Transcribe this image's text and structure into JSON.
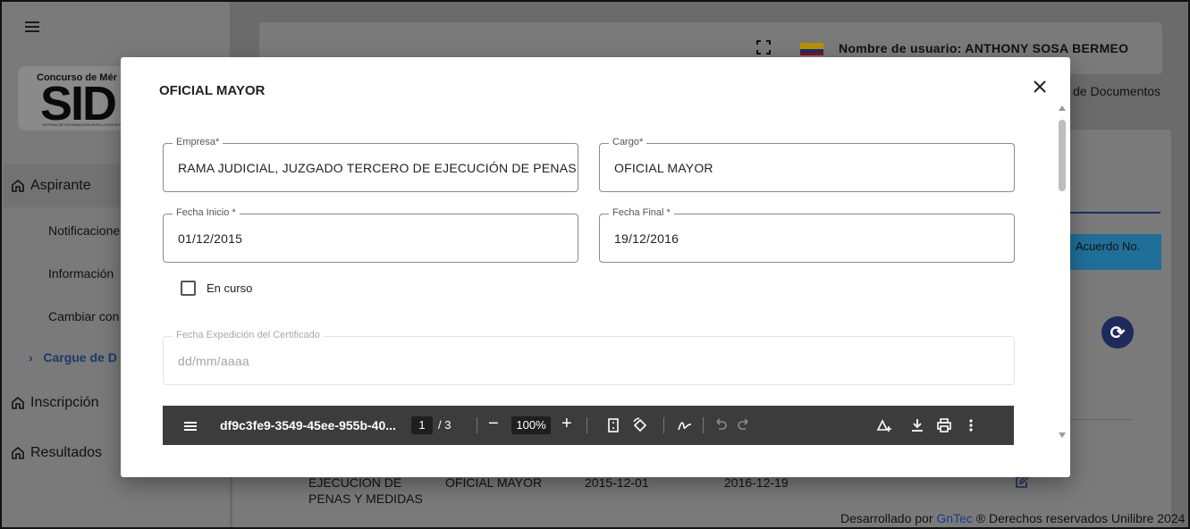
{
  "sidebar": {
    "logo": {
      "top": "Concurso de Mér",
      "big": "SID",
      "sub": "SISTEMA DE INFORMACIÓN PARA LA INSCRIPCIÓN"
    },
    "items": [
      {
        "label": "Aspirante"
      },
      {
        "label": "Inscripción"
      },
      {
        "label": "Resultados"
      }
    ],
    "sub_items": [
      {
        "label": "Notificacione"
      },
      {
        "label": "Información"
      },
      {
        "label": "Cambiar con"
      },
      {
        "label": "Cargue de D"
      }
    ],
    "current_marker": "›"
  },
  "header": {
    "user_label": "Nombre de usuario: ANTHONY SOSA BERMEO",
    "breadcrumb": "de Documentos"
  },
  "background": {
    "acuerdo": "Acuerdo No.",
    "row": {
      "empresa_line1": "EJECUCION DE",
      "empresa_line2": "PENAS Y MEDIDAS",
      "cargo": "OFICIAL MAYOR",
      "inicio": "2015-12-01",
      "fin": "2016-12-19"
    }
  },
  "footer": {
    "prefix": "Desarrollado por ",
    "link": "GnTec",
    "suffix": " ® Derechos reservados Unilibre 2024"
  },
  "modal": {
    "title": "OFICIAL MAYOR",
    "fields": {
      "empresa": {
        "label": "Empresa*",
        "value": "RAMA JUDICIAL, JUZGADO TERCERO DE EJECUCIÓN DE PENAS Y"
      },
      "cargo": {
        "label": "Cargo*",
        "value": "OFICIAL MAYOR"
      },
      "fecha_inicio": {
        "label": "Fecha Inicio *",
        "value": "01/12/2015"
      },
      "fecha_final": {
        "label": "Fecha Final *",
        "value": "19/12/2016"
      },
      "fecha_expedicion": {
        "label": "Fecha Expedición del Certificado",
        "placeholder": "dd/mm/aaaa"
      }
    },
    "en_curso": {
      "label": "En curso",
      "checked": false
    },
    "pdf_viewer": {
      "file_name": "df9c3fe9-3549-45ee-955b-40...",
      "page": "1",
      "total": "/ 3",
      "zoom": "100%",
      "minus": "−",
      "plus": "+"
    }
  },
  "colors": {
    "accent": "#1e2a5c",
    "flag_yellow": "#f2c200",
    "flag_blue": "#1b3f94",
    "flag_red": "#c8102e"
  }
}
